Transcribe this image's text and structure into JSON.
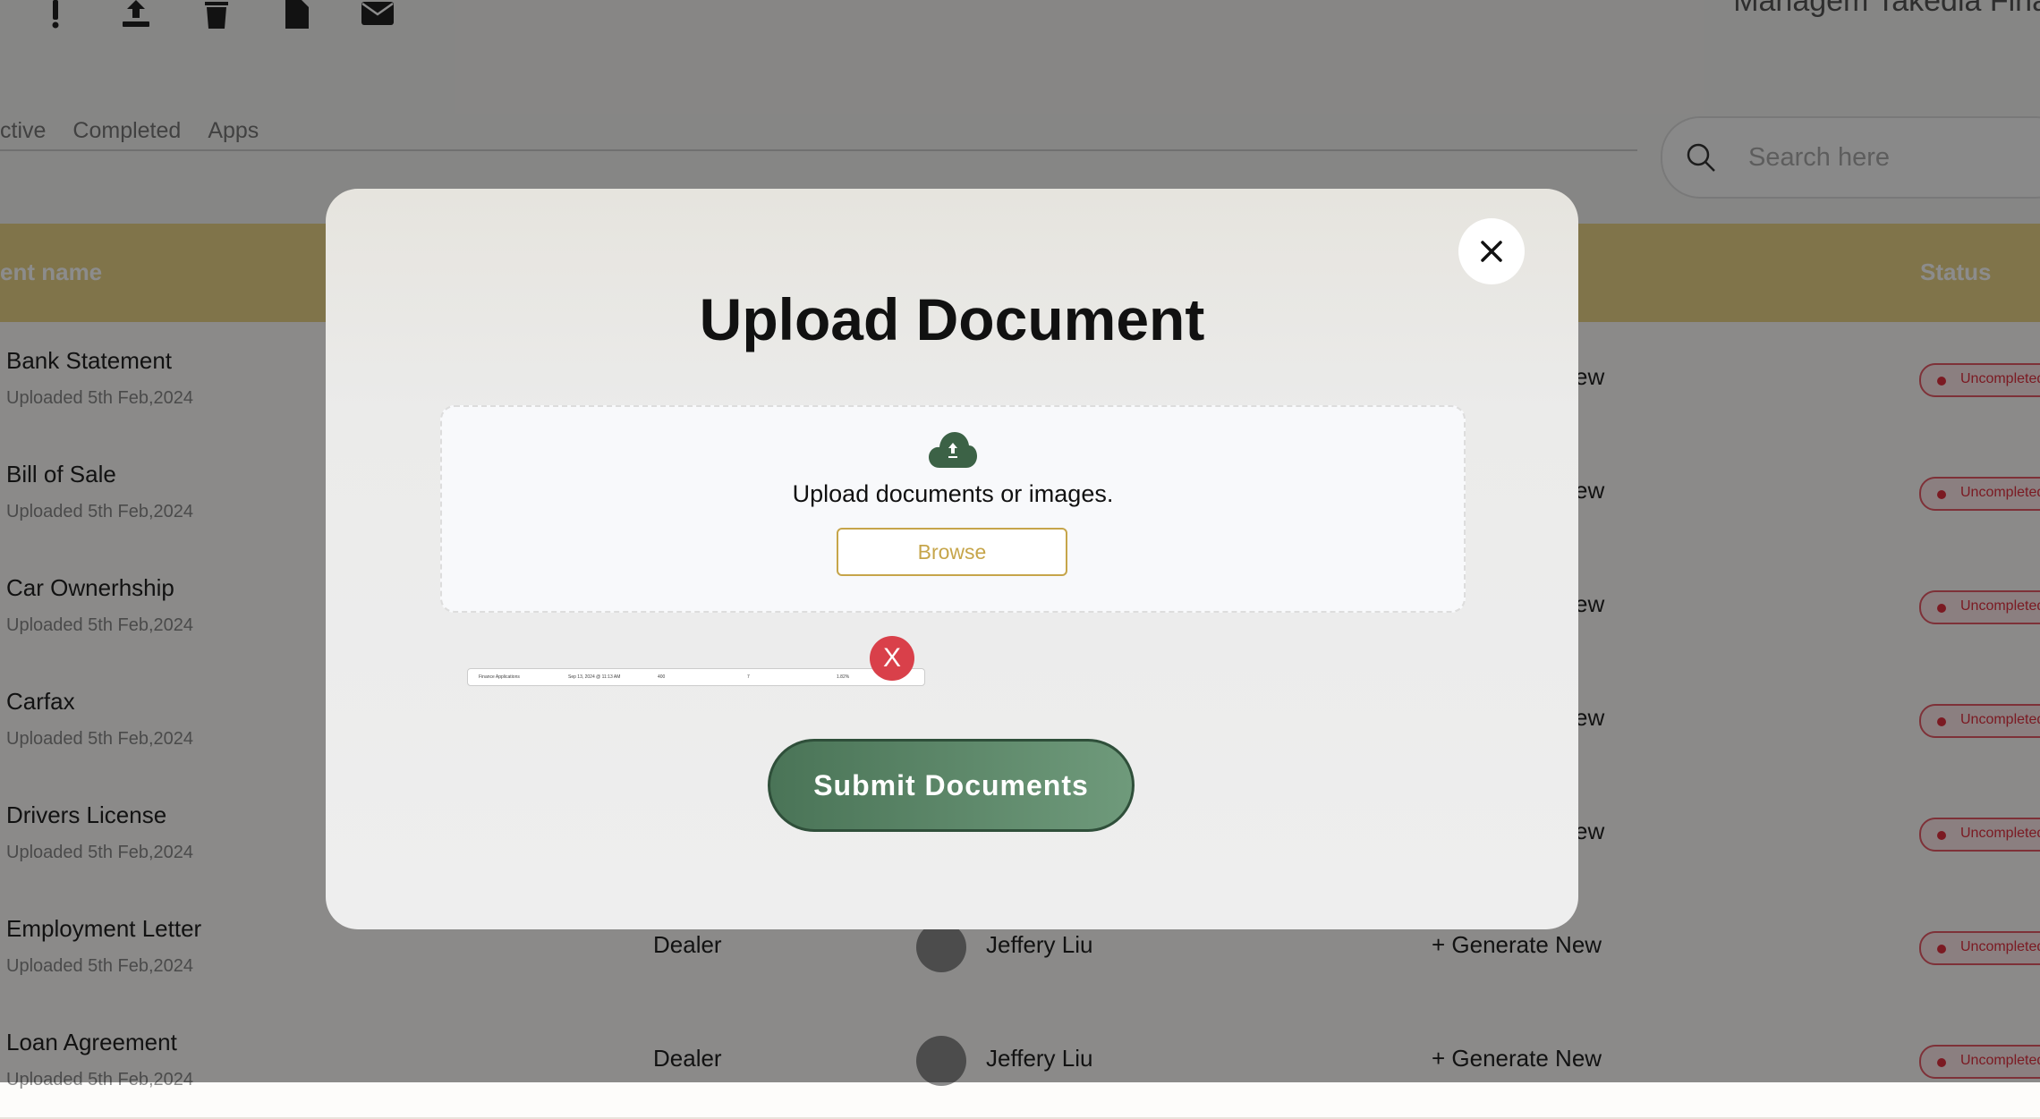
{
  "toolbar": {
    "icons": [
      "exclamation-icon",
      "upload-icon",
      "trash-icon",
      "file-icon",
      "mail-icon"
    ],
    "right_text": "Managem Takedia Fina"
  },
  "tabs": [
    "ctive",
    "Completed",
    "Apps"
  ],
  "search": {
    "placeholder": "Search here"
  },
  "table": {
    "headers": {
      "name": "ent name",
      "status": "Status"
    },
    "rows": [
      {
        "name": "Bank Statement",
        "date": "Uploaded 5th Feb,2024",
        "dealer": "",
        "person": "",
        "action": "ew",
        "status": "Uncompleted"
      },
      {
        "name": "Bill of Sale",
        "date": "Uploaded 5th Feb,2024",
        "dealer": "",
        "person": "",
        "action": "ew",
        "status": "Uncompleted"
      },
      {
        "name": "Car Ownerhship",
        "date": "Uploaded 5th Feb,2024",
        "dealer": "",
        "person": "",
        "action": "ew",
        "status": "Uncompleted"
      },
      {
        "name": "Carfax",
        "date": "Uploaded 5th Feb,2024",
        "dealer": "",
        "person": "",
        "action": "ew",
        "status": "Uncompleted"
      },
      {
        "name": "Drivers License",
        "date": "Uploaded 5th Feb,2024",
        "dealer": "",
        "person": "",
        "action": "ew",
        "status": "Uncompleted"
      },
      {
        "name": "Employment Letter",
        "date": "Uploaded 5th Feb,2024",
        "dealer": "Dealer",
        "person": "Jeffery Liu",
        "action": "+ Generate New",
        "status": "Uncompleted"
      },
      {
        "name": "Loan Agreement",
        "date": "Uploaded 5th Feb,2024",
        "dealer": "Dealer",
        "person": "Jeffery Liu",
        "action": "+ Generate New",
        "status": "Uncompleted"
      }
    ]
  },
  "modal": {
    "title": "Upload Document",
    "drop_text": "Upload documents or images.",
    "browse_label": "Browse",
    "remove_label": "X",
    "submit_label": "Submit Documents",
    "preview": [
      "Finance Applications",
      "Sep 13, 2024 @ 11:13 AM",
      "400",
      "7",
      "1.82%"
    ]
  },
  "colors": {
    "header": "#e9d488",
    "accent_gold": "#c6a54a",
    "submit_green": "#4a7457",
    "status_red": "#e0303f"
  }
}
